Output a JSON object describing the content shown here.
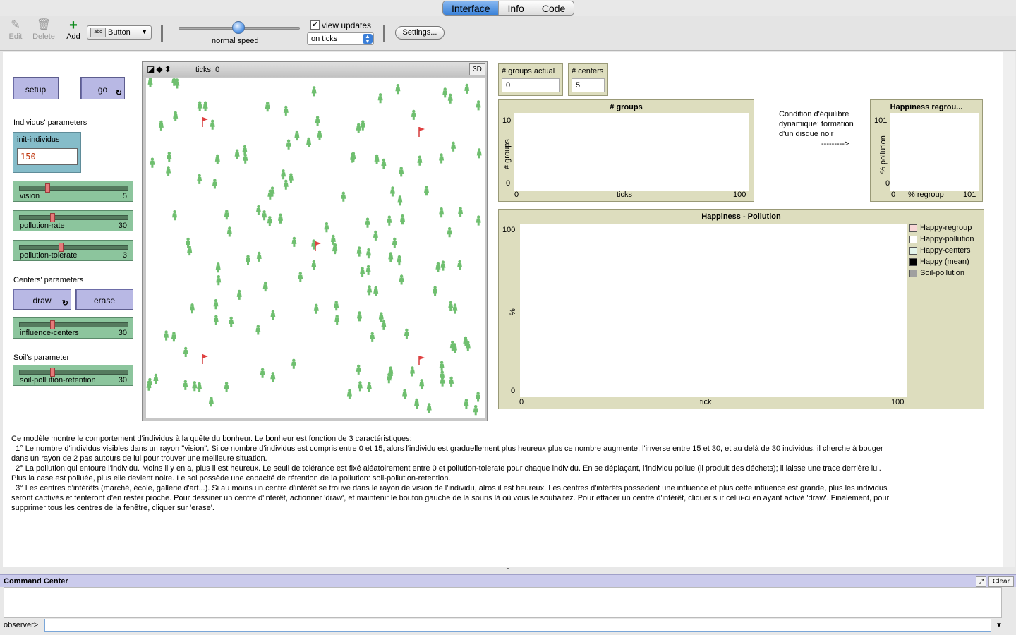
{
  "tabs": [
    {
      "label": "Interface",
      "active": true
    },
    {
      "label": "Info",
      "active": false
    },
    {
      "label": "Code",
      "active": false
    }
  ],
  "toolbar": {
    "edit_label": "Edit",
    "delete_label": "Delete",
    "add_label": "Add",
    "widget_type": "Button",
    "widget_icon_text": "abc",
    "speed_label": "normal speed",
    "speed_value": 0.5,
    "view_updates_label": "view updates",
    "view_updates_checked": true,
    "update_mode": "on ticks",
    "settings_label": "Settings..."
  },
  "buttons": {
    "setup": "setup",
    "go": "go",
    "draw": "draw",
    "erase": "erase"
  },
  "sections": {
    "individus": "Individus' parameters",
    "centers": "Centers' parameters",
    "soil": "Soil's parameter"
  },
  "inputs": {
    "init_individus": {
      "label": "init-individus",
      "value": "150"
    }
  },
  "sliders": {
    "vision": {
      "label": "vision",
      "value": "5",
      "level": 0.25
    },
    "pollution_rate": {
      "label": "pollution-rate",
      "value": "30",
      "level": 0.3
    },
    "pollution_tolerate": {
      "label": "pollution-tolerate",
      "value": "3",
      "level": 0.38
    },
    "influence_centers": {
      "label": "influence-centers",
      "value": "30",
      "level": 0.3
    },
    "soil_pollution_retention": {
      "label": "soil-pollution-retention",
      "value": "30",
      "level": 0.3
    }
  },
  "view": {
    "ticks_label": "ticks: 0",
    "three_d_label": "3D"
  },
  "monitors": {
    "groups_actual": {
      "label": "# groups actual",
      "value": "0"
    },
    "centers": {
      "label": "# centers",
      "value": "5"
    }
  },
  "plot_groups": {
    "title": "# groups",
    "ylabel": "# groups",
    "xlabel": "ticks",
    "ymax": "10",
    "ymin": "0",
    "xmin": "0",
    "xmax": "100"
  },
  "plot_regroup": {
    "title": "Happiness   regrou...",
    "ylabel": "% pollution",
    "xlabel": "% regroup",
    "ymax": "101",
    "ymin": "0",
    "xmin": "0",
    "xmax": "101"
  },
  "plot_happiness": {
    "title": "Happiness - Pollution",
    "ylabel": "%",
    "xlabel": "tick",
    "ymax": "100",
    "ymin": "0",
    "xmin": "0",
    "xmax": "100",
    "legend": [
      {
        "name": "Happy-regroup",
        "color": "#f7d6d6"
      },
      {
        "name": "Happy-pollution",
        "color": "#ffffff"
      },
      {
        "name": "Happy-centers",
        "color": "#e4f4ea"
      },
      {
        "name": "Happy (mean)",
        "color": "#000000"
      },
      {
        "name": "Soil-pollution",
        "color": "#a0a0a0"
      }
    ]
  },
  "note": {
    "line1": "Condition d'équilibre",
    "line2": "dynamique: formation",
    "line3": "d'un disque noir",
    "arrow": "--------->"
  },
  "info_text": "Ce modèle montre le comportement d'individus à la quête du bonheur. Le bonheur est fonction de 3 caractéristiques:\n  1° Le nombre d'individus visibles dans un rayon \"vision\". Si ce nombre d'individus est compris entre 0 et 15, alors l'individu est graduellement plus heureux plus ce nombre augmente, l'inverse entre 15 et 30, et au delà de 30 individus, il cherche à bouger\ndans un rayon de 2 pas autours de lui pour trouver une meilleure situation.\n  2° La pollution qui entoure l'individu. Moins il y en a, plus il est heureux. Le seuil de tolérance est fixé aléatoirement entre 0 et pollution-tolerate pour chaque individu. En se déplaçant, l'individu pollue (il produit des déchets); il laisse une trace derrière lui.\nPlus la case est polluée, plus elle devient noire. Le sol possède une capacité de rétention de la pollution: soil-pollution-retention.\n  3° Les centres d'intérêts (marché, école, gallerie d'art...). Si au moins un centre d'intérêt se trouve dans le rayon de vision de l'individu, alros il est heureux. Les centres d'intérêts possèdent une influence et plus cette influence est grande, plus les individus\nseront captivés et tenteront d'en rester proche. Pour dessiner un centre d'intérêt, actionner 'draw', et maintenir le bouton gauche de la souris là où vous le souhaitez. Pour effacer un centre d'intérêt, cliquer sur celui-ci en ayant activé 'draw'. Finalement, pour\nsupprimer tous les centres de la fenêtre, cliquer sur 'erase'.",
  "command_center": {
    "title": "Command Center",
    "clear_label": "Clear",
    "prompt": "observer>"
  }
}
